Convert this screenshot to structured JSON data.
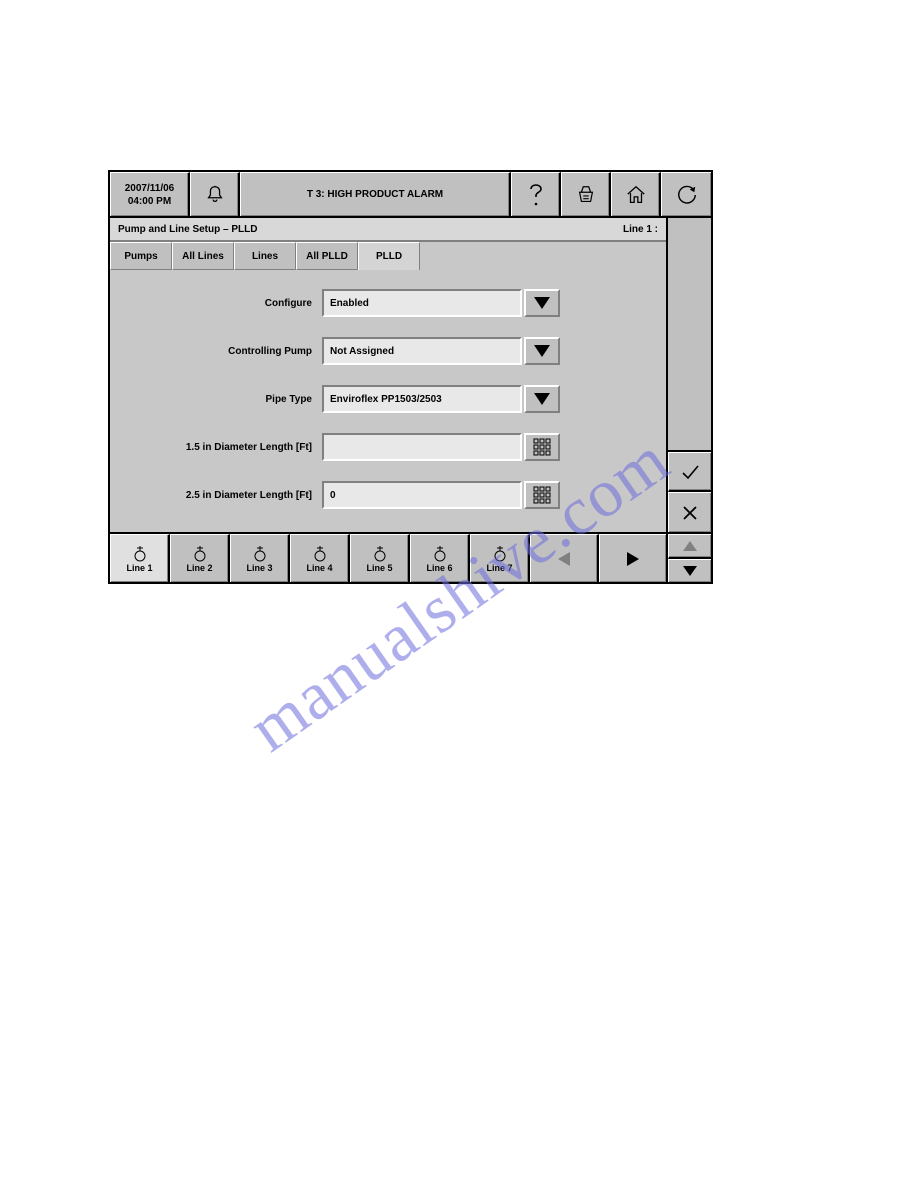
{
  "header": {
    "date": "2007/11/06",
    "time": "04:00 PM",
    "alarm_text": "T 3: HIGH PRODUCT ALARM"
  },
  "subheader": {
    "title": "Pump and Line Setup – PLLD",
    "context": "Line 1 :"
  },
  "tabs": [
    "Pumps",
    "All Lines",
    "Lines",
    "All PLLD",
    "PLLD"
  ],
  "active_tab": 4,
  "form": {
    "rows": [
      {
        "label": "Configure",
        "value": "Enabled",
        "type": "dropdown"
      },
      {
        "label": "Controlling Pump",
        "value": "Not Assigned",
        "type": "dropdown"
      },
      {
        "label": "Pipe Type",
        "value": "Enviroflex PP1503/2503",
        "type": "dropdown"
      },
      {
        "label": "1.5 in Diameter Length [Ft]",
        "value": "",
        "type": "keypad"
      },
      {
        "label": "2.5 in Diameter Length [Ft]",
        "value": "0",
        "type": "keypad"
      }
    ]
  },
  "lines": [
    "Line 1",
    "Line 2",
    "Line 3",
    "Line 4",
    "Line 5",
    "Line 6",
    "Line 7"
  ],
  "active_line": 0,
  "watermark": "manualshive.com"
}
